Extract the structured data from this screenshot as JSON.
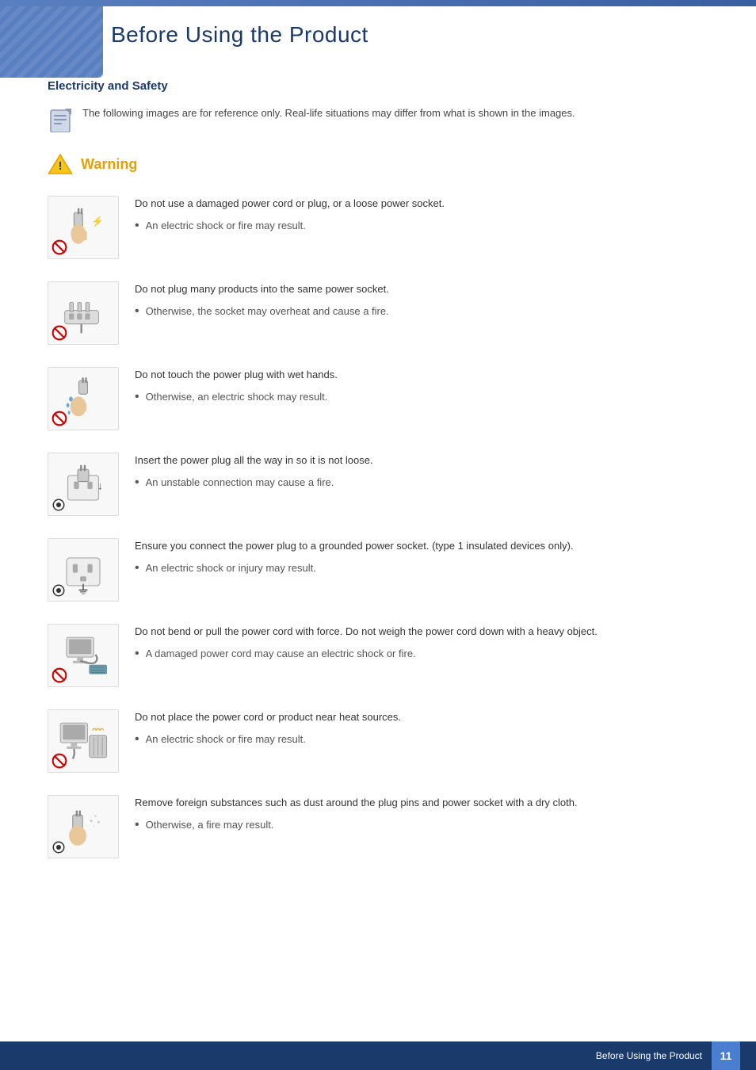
{
  "page": {
    "title": "Before Using the Product",
    "top_accent_color": "#5a7fc0",
    "heading_color": "#1a3a6b"
  },
  "section": {
    "title": "Electricity and Safety"
  },
  "note": {
    "text": "The following images are for reference only. Real-life situations may differ from what is shown in the images."
  },
  "warning": {
    "label": "Warning"
  },
  "items": [
    {
      "id": 1,
      "main_text": "Do not use a damaged power cord or plug, or a loose power socket.",
      "bullet_text": "An electric shock or fire may result.",
      "has_prohibited": true
    },
    {
      "id": 2,
      "main_text": "Do not plug many products into the same power socket.",
      "bullet_text": "Otherwise, the socket may overheat and cause a fire.",
      "has_prohibited": true
    },
    {
      "id": 3,
      "main_text": "Do not touch the power plug with wet hands.",
      "bullet_text": "Otherwise, an electric shock may result.",
      "has_prohibited": true
    },
    {
      "id": 4,
      "main_text": "Insert the power plug all the way in so it is not loose.",
      "bullet_text": "An unstable connection may cause a fire.",
      "has_prohibited": false
    },
    {
      "id": 5,
      "main_text": "Ensure you connect the power plug to a grounded power socket. (type 1 insulated devices only).",
      "bullet_text": "An electric shock or injury may result.",
      "has_prohibited": false
    },
    {
      "id": 6,
      "main_text": "Do not bend or pull the power cord with force. Do not weigh the power cord down with a heavy object.",
      "bullet_text": "A damaged power cord may cause an electric shock or fire.",
      "has_prohibited": true
    },
    {
      "id": 7,
      "main_text": "Do not place the power cord or product near heat sources.",
      "bullet_text": "An electric shock or fire may result.",
      "has_prohibited": true
    },
    {
      "id": 8,
      "main_text": "Remove foreign substances such as dust around the plug pins and power socket with a dry cloth.",
      "bullet_text": "Otherwise, a fire may result.",
      "has_prohibited": false
    }
  ],
  "footer": {
    "text": "Before Using the Product",
    "page_number": "11"
  }
}
